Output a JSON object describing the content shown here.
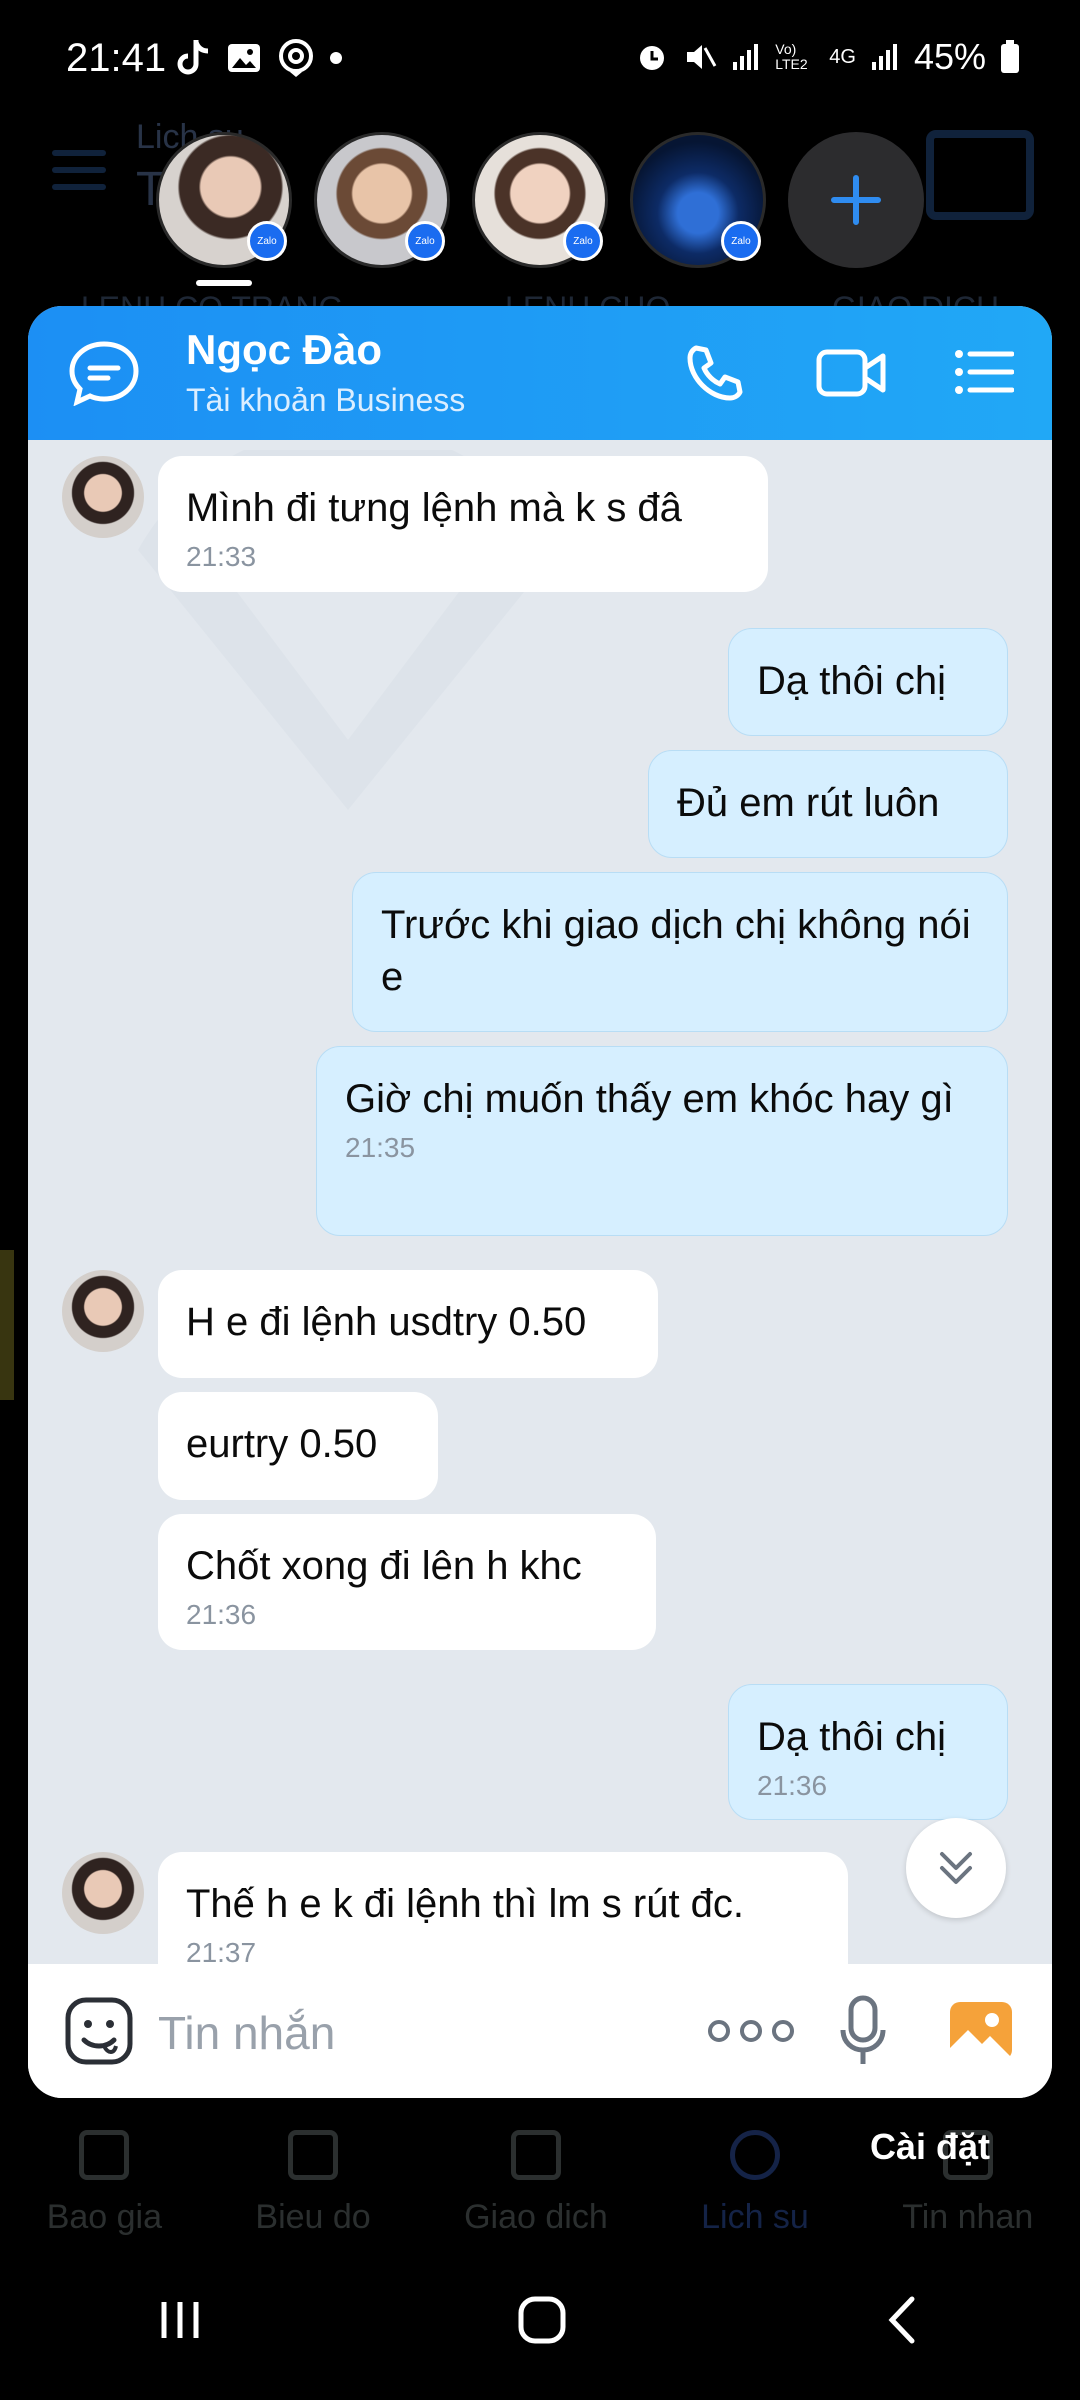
{
  "status_bar": {
    "time": "21:41",
    "battery": "45%",
    "network": "4G",
    "volte": "Vo) LTE2",
    "icons_left": [
      "tiktok-icon",
      "image-icon",
      "location-icon"
    ],
    "icons_right": [
      "alarm-icon",
      "mute-icon",
      "signal-icon",
      "signal-icon",
      "battery-icon"
    ]
  },
  "background_app": {
    "title": "Lich su",
    "subtitle": "Tr",
    "tabs": [
      "LENH CO TRANG",
      "LENH CHO",
      "GIAO DICH"
    ],
    "bottom_nav": [
      {
        "label": "Bao gia",
        "icon": "arrows-updown-icon"
      },
      {
        "label": "Bieu do",
        "icon": "candlestick-icon"
      },
      {
        "label": "Giao dich",
        "icon": "trend-icon"
      },
      {
        "label": "Lich su",
        "icon": "history-icon",
        "active": true
      },
      {
        "label": "Tin nhan",
        "icon": "chat-icon"
      }
    ]
  },
  "chat_bubbles": {
    "items": [
      {
        "badge": "Zalo"
      },
      {
        "badge": "Zalo"
      },
      {
        "badge": "Zalo"
      },
      {
        "badge": "Zalo"
      }
    ],
    "add_label": "+"
  },
  "chat": {
    "contact_name": "Ngọc Đào",
    "contact_sub": "Tài khoản Business",
    "messages": [
      {
        "dir": "in",
        "text": "Mình đi tưng lệnh mà k s đâ",
        "time": "21:33",
        "avatar": true
      },
      {
        "dir": "out",
        "text": "Dạ thôi chị",
        "time": ""
      },
      {
        "dir": "out",
        "text": "Đủ em rút luôn",
        "time": ""
      },
      {
        "dir": "out",
        "text": "Trước khi giao dịch chị không nói e",
        "time": ""
      },
      {
        "dir": "out",
        "text": "Giờ chị muốn thấy em khóc hay gì",
        "time": "21:35"
      },
      {
        "dir": "in",
        "text": "H e đi lệnh usdtry 0.50",
        "time": "",
        "avatar": true
      },
      {
        "dir": "in",
        "text": "eurtry  0.50",
        "time": ""
      },
      {
        "dir": "in",
        "text": "Chốt xong đi lên h khc",
        "time": "21:36"
      },
      {
        "dir": "out",
        "text": "Dạ thôi chị",
        "time": "21:36"
      },
      {
        "dir": "in",
        "text": "Thế h e k đi lệnh thì lm s rút đc.",
        "time": "21:37",
        "avatar": true
      }
    ],
    "input_placeholder": "Tin nhắn"
  },
  "overlay_label": "Cài đặt",
  "colors": {
    "header_blue": "#1c8ff4",
    "out_bubble": "#d6efff",
    "in_bubble": "#ffffff",
    "chat_bg": "#e3e8ee",
    "image_button": "#f5a23a"
  }
}
